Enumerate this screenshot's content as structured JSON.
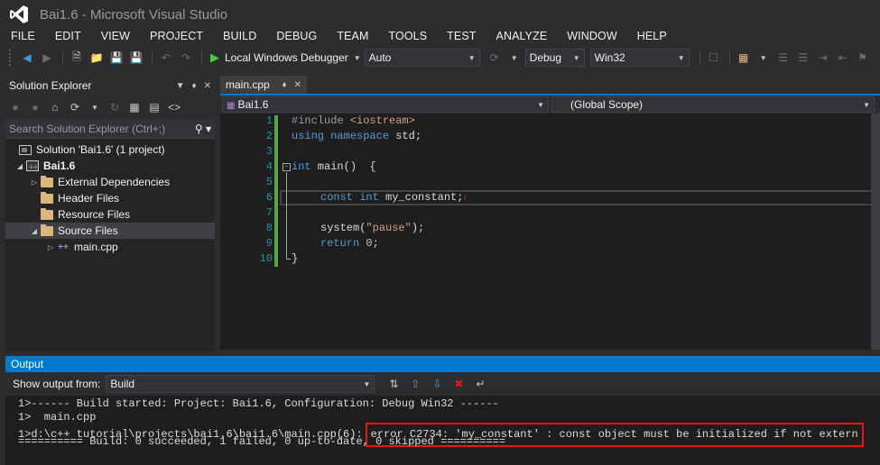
{
  "window": {
    "title": "Bai1.6 - Microsoft Visual Studio"
  },
  "menu": [
    "FILE",
    "EDIT",
    "VIEW",
    "PROJECT",
    "BUILD",
    "DEBUG",
    "TEAM",
    "TOOLS",
    "TEST",
    "ANALYZE",
    "WINDOW",
    "HELP"
  ],
  "toolbar": {
    "debugger_label": "Local Windows Debugger",
    "solution_config": "Auto",
    "build_config": "Debug",
    "platform": "Win32"
  },
  "solution_explorer": {
    "title": "Solution Explorer",
    "search_placeholder": "Search Solution Explorer (Ctrl+;)",
    "solution": "Solution 'Bai1.6' (1 project)",
    "project": "Bai1.6",
    "items": [
      "External Dependencies",
      "Header Files",
      "Resource Files",
      "Source Files"
    ],
    "file": "main.cpp"
  },
  "editor": {
    "tab": "main.cpp",
    "nav_project": "Bai1.6",
    "nav_scope": "(Global Scope)",
    "line_numbers": [
      "1",
      "2",
      "3",
      "4",
      "5",
      "6",
      "7",
      "8",
      "9",
      "10"
    ],
    "code": {
      "l1_directive": "#include",
      "l1_header": " <iostream>",
      "l2_using": "using",
      "l2_namespace": " namespace",
      "l2_rest": " std;",
      "l4_int": "int",
      "l4_rest": " main()  {",
      "l6_const": "const",
      "l6_int": " int",
      "l6_rest": " my_constant",
      "l6_semi": ";",
      "l8_call": "system(",
      "l8_str": "\"pause\"",
      "l8_end": ");",
      "l9_return": "return",
      "l9_num": " 0",
      "l9_end": ";",
      "l10": "}"
    }
  },
  "output": {
    "title": "Output",
    "show_from_label": "Show output from:",
    "source": "Build",
    "lines": [
      "1>------ Build started: Project: Bai1.6, Configuration: Debug Win32 ------",
      "1>  main.cpp",
      "1>d:\\c++ tutorial\\projects\\bai1.6\\bai1.6\\main.cpp(6):",
      "========== Build: 0 succeeded, 1 failed, 0 up-to-date, 0 skipped =========="
    ],
    "error": "error C2734: 'my_constant' : const object must be initialized if not extern"
  }
}
